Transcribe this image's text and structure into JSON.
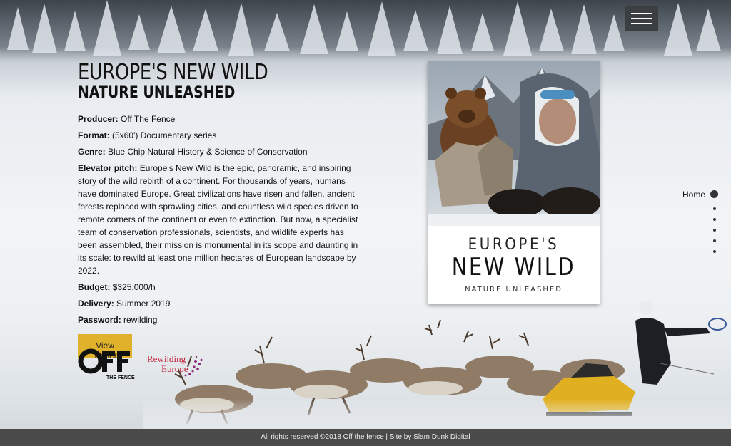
{
  "header": {
    "menu_icon": "hamburger-menu-icon"
  },
  "main": {
    "title": "EUROPE'S NEW WILD",
    "subtitle": "NATURE UNLEASHED",
    "producer_label": "Producer:",
    "producer_value": "Off The Fence",
    "format_label": "Format:",
    "format_value": "(5x60') Documentary series",
    "genre_label": "Genre:",
    "genre_value": "Blue Chip Natural History & Science of Conservation",
    "pitch_label": "Elevator pitch:",
    "pitch_value": "Europe's New Wild is the epic, panoramic, and inspiring story of the wild rebirth of a continent. For thousands of years, humans have dominated Europe. Great civilizations have risen and fallen, ancient forests replaced with sprawling cities, and countless wild species driven to remote corners of the continent or even to extinction. But now, a specialist team of conservation professionals, scientists, and wildlife experts has been assembled, their mission is monumental in its scope and daunting in its scale: to rewild at least one million hectares of European landscape by 2022.",
    "budget_label": "Budget:",
    "budget_value": "$325,000/h",
    "delivery_label": "Delivery:",
    "delivery_value": "Summer 2019",
    "password_label": "Password:",
    "password_value": "rewilding",
    "trailer_button": "View Trailer"
  },
  "logos": {
    "off_main": "OFF",
    "off_sub": "THE FENCE",
    "rewilding_line1": "Rewilding",
    "rewilding_line2": "Europe"
  },
  "poster": {
    "line1": "EUROPE'S",
    "line2": "NEW WILD",
    "line3": "NATURE UNLEASHED"
  },
  "side_nav": {
    "home": "Home",
    "dots": 5
  },
  "footer": {
    "text_prefix": "All rights reserved ©2018 ",
    "link1": "Off the fence",
    "separator": " | Site by ",
    "link2": "Slam Dunk Digital"
  },
  "colors": {
    "button_gold": "#e0b22c",
    "footer_bg": "#4a4a4a",
    "menu_bg": "#3c3f42",
    "rewilding_purple": "#8b2a7a",
    "rewilding_red": "#c0203c"
  }
}
